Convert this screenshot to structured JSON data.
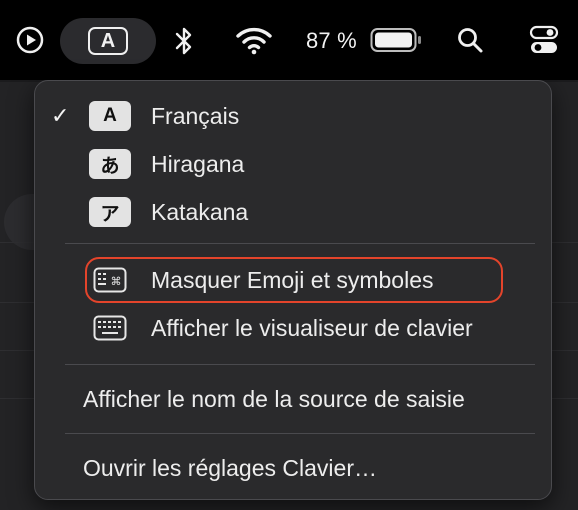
{
  "menubar": {
    "input_badge": "A",
    "battery_text": "87 %"
  },
  "menu": {
    "languages": [
      {
        "badge": "A",
        "label": "Français",
        "checked": true
      },
      {
        "badge": "あ",
        "label": "Hiragana",
        "checked": false
      },
      {
        "badge": "ア",
        "label": "Katakana",
        "checked": false
      }
    ],
    "emoji_label": "Masquer Emoji et symboles",
    "keyboard_viewer_label": "Afficher le visualiseur de clavier",
    "show_source_name_label": "Afficher le nom de la source de saisie",
    "open_settings_label": "Ouvrir les réglages Clavier…",
    "check_mark": "✓"
  },
  "colors": {
    "highlight": "#e4442b",
    "menu_bg": "#2a2a2c",
    "badge_bg": "#e3e3e3"
  },
  "icons": [
    "play-circle-icon",
    "bluetooth-icon",
    "wifi-icon",
    "battery-icon",
    "search-icon",
    "control-center-icon",
    "emoji-keyboard-icon",
    "keyboard-icon"
  ]
}
